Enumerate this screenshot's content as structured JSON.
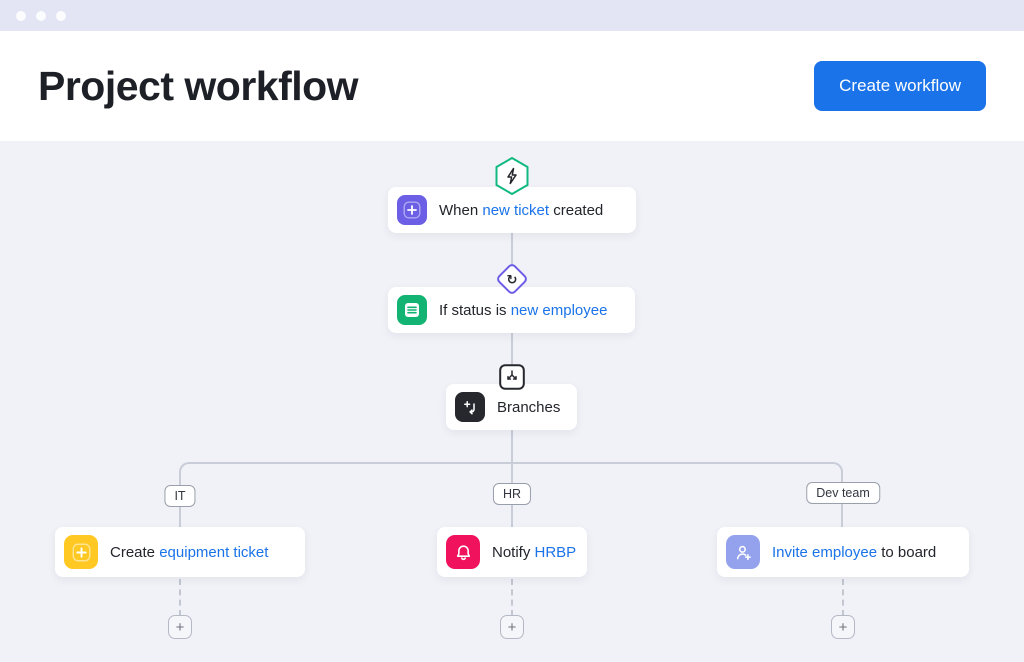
{
  "titlebar": {
    "dot_count": 3
  },
  "header": {
    "title": "Project workflow",
    "create_button_label": "Create workflow"
  },
  "workflow": {
    "trigger_node": {
      "prefix": "When ",
      "link": "new ticket",
      "suffix": " created"
    },
    "condition_node": {
      "prefix": "If status is ",
      "link": "new employee",
      "suffix": ""
    },
    "branches_node": {
      "label": "Branches"
    },
    "branch_labels": {
      "it": "IT",
      "hr": "HR",
      "dev": "Dev team"
    },
    "action_nodes": {
      "equipment": {
        "prefix": "Create ",
        "link": "equipment ticket",
        "suffix": ""
      },
      "notify": {
        "prefix": "Notify ",
        "link": "HRBP",
        "suffix": ""
      },
      "invite": {
        "prefix": "",
        "link": "Invite employee",
        "suffix": " to board"
      }
    },
    "add_step_glyph": "+"
  },
  "icons": {
    "loop_glyph": "↻"
  },
  "colors": {
    "topbar_bg": "#e3e5f4",
    "canvas_bg": "#f1f2f8",
    "primary_button_bg": "#1a73e8",
    "link_text": "#1a73e8",
    "connector": "#c9cdd8",
    "trigger_icon_bg": "#6c5fe6",
    "condition_icon_bg": "#12b373",
    "branches_icon_bg": "#26282e",
    "equipment_icon_bg": "#ffc822",
    "notify_icon_bg": "#f1125e",
    "invite_icon_bg": "#94a1ed",
    "hexagon_stroke": "#10b981",
    "diamond_stroke": "#6c5ce7"
  }
}
